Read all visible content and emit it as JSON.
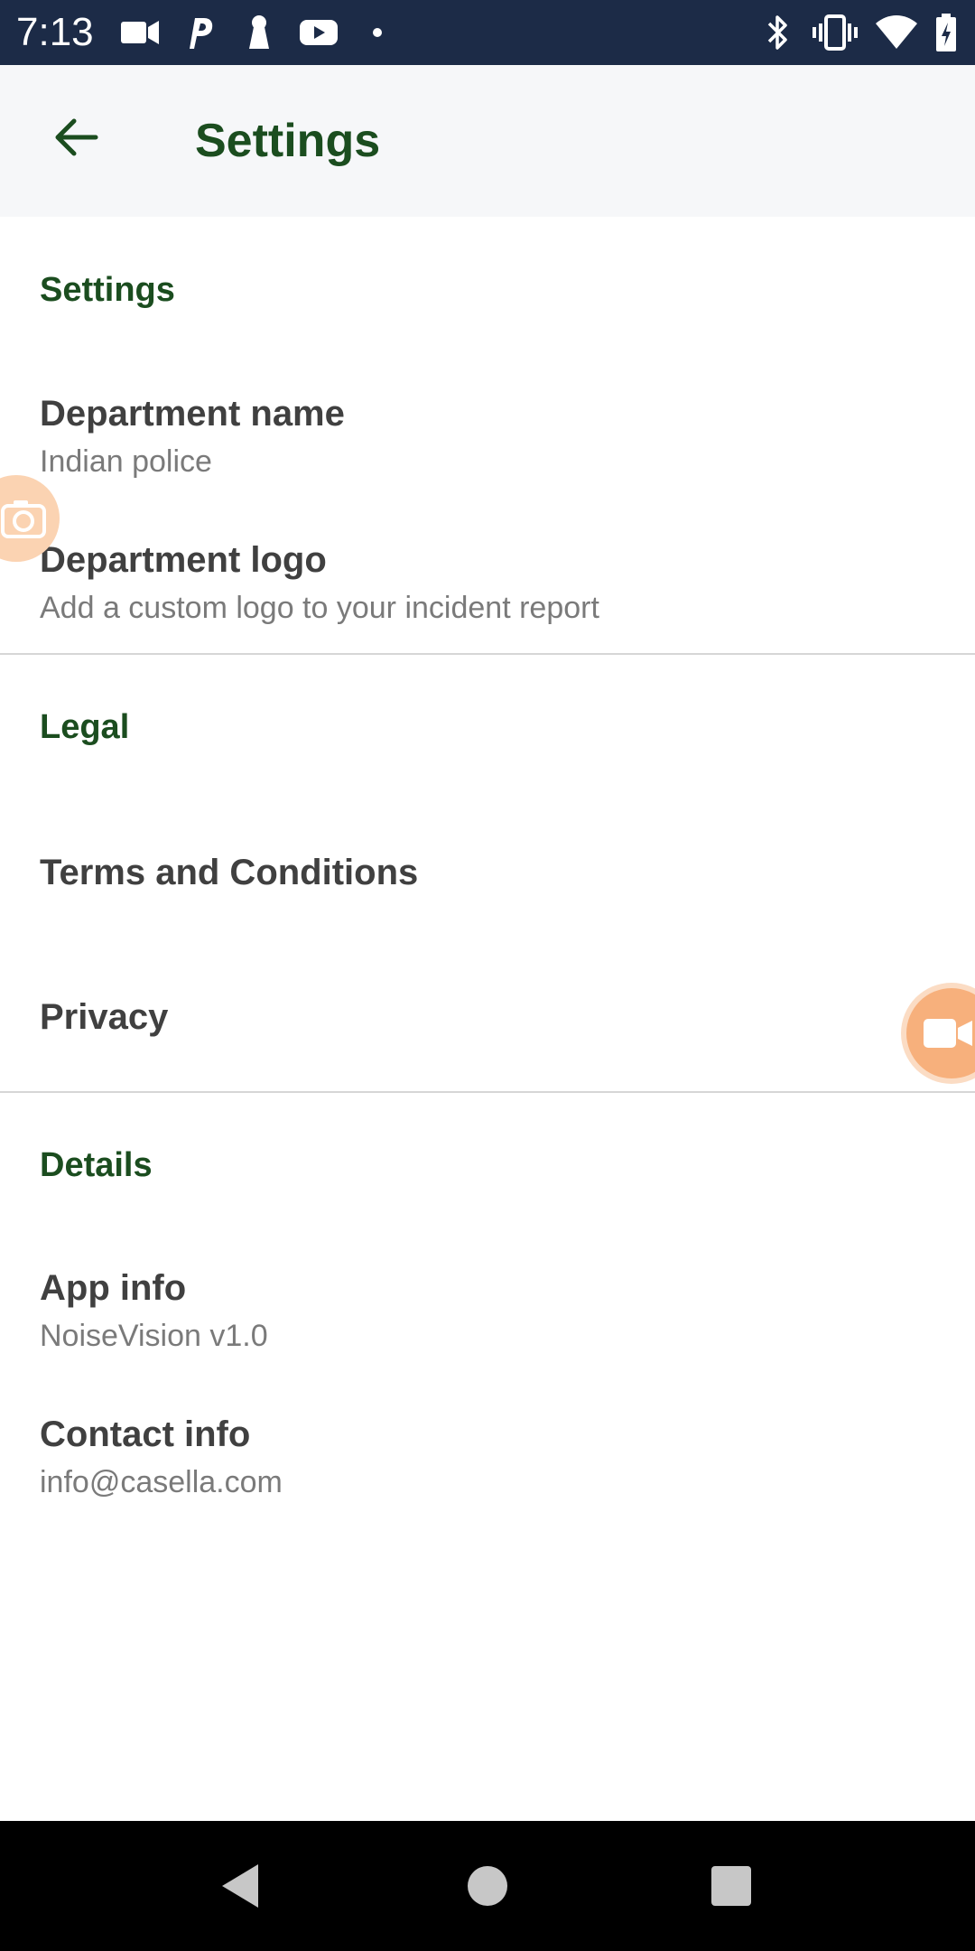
{
  "status_bar": {
    "time": "7:13",
    "icons_left": [
      "video-camera-icon",
      "p-icon",
      "keyhole-icon",
      "youtube-icon",
      "dot-icon"
    ],
    "icons_right": [
      "bluetooth-icon",
      "vibrate-icon",
      "wifi-icon",
      "battery-icon"
    ]
  },
  "app_bar": {
    "title": "Settings",
    "back_icon": "arrow-back-icon"
  },
  "sections": {
    "settings": {
      "header": "Settings",
      "items": [
        {
          "title": "Department name",
          "subtitle": "Indian police"
        },
        {
          "title": "Department logo",
          "subtitle": "Add a custom logo to your incident report"
        }
      ]
    },
    "legal": {
      "header": "Legal",
      "items": [
        {
          "title": "Terms and Conditions"
        },
        {
          "title": "Privacy"
        }
      ]
    },
    "details": {
      "header": "Details",
      "items": [
        {
          "title": "App info",
          "subtitle": "NoiseVision v1.0"
        },
        {
          "title": "Contact info",
          "subtitle": "info@casella.com"
        }
      ]
    }
  },
  "colors": {
    "accent_green": "#1b4d1f",
    "status_bar": "#1c2b47",
    "bubble_orange": "#f7b07c"
  },
  "nav_bar": {
    "icons": [
      "nav-back-icon",
      "nav-home-icon",
      "nav-recents-icon"
    ]
  }
}
